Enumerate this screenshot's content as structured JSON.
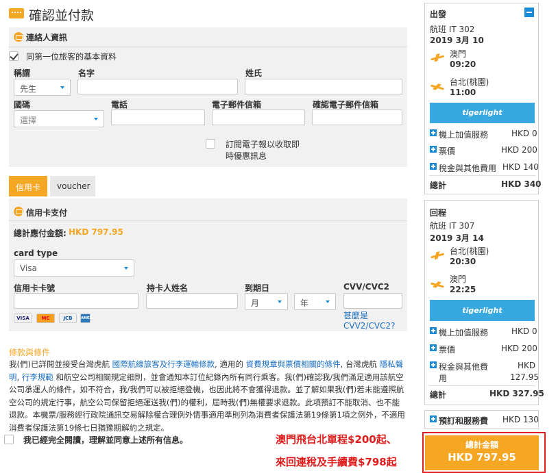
{
  "page_title": "確認並付款",
  "contact": {
    "section_title": "連絡人資訊",
    "same_as_first": "同第一位旅客的基本資料",
    "title_label": "稱謂",
    "title_value": "先生",
    "first_name_label": "名字",
    "last_name_label": "姓氏",
    "country_label": "國碼",
    "country_placeholder": "選擇",
    "phone_label": "電話",
    "email_label": "電子郵件信箱",
    "confirm_email_label": "確認電子郵件信箱",
    "newsletter_line1": "訂閱電子報以收取即",
    "newsletter_line2": "時優惠訊息"
  },
  "payment_tabs": [
    "信用卡",
    "voucher"
  ],
  "card": {
    "section_title": "信用卡支付",
    "total_label": "總計應付金額:",
    "total_value": "HKD 797.95",
    "card_type_label": "card type",
    "card_type_value": "Visa",
    "number_label": "信用卡卡號",
    "holder_label": "持卡人姓名",
    "expiry_label": "到期日",
    "month_placeholder": "月",
    "year_placeholder": "年",
    "cvv_label": "CVV/CVC2",
    "cvv_help_1": "甚麼是",
    "cvv_help_2": "CVV2/CVC2?",
    "brands": [
      "VISA",
      "MC",
      "JCB",
      "AMEX"
    ]
  },
  "terms": {
    "title": "條款與條件",
    "t1": "我(們)已詳閱並接受台灣虎航 ",
    "l1": "國際航線旅客及行李運輸條款",
    "t2": ", 適用的 ",
    "l2": "資費規章與票價相關的條件",
    "t3": ", 台灣虎航 ",
    "l3": "隱私聲明",
    "t4": ", ",
    "l4": "行李規範",
    "t5": " 和航空公司相關規定細則，並會通知本訂位紀錄內所有同行乘客。我(們)確認我/我們滿足適用該航空公司承運人的條件，如不符合，我/我們可以被拒絕登機，也因此將不會獲得退款。並了解如果我(們)若未能遵照航空公司的規定行事，航空公司保留拒絕運送我(們)的權利，屆時我(們)無權要求退款。此項預訂不能取消、也不能退款。本機票/服務經行政院通訊交易解除權合理例外情事適用準則列為消費者保護法第19條第1項之例外，不適用消費者保護法第19條七日猶豫期解約之規定。",
    "agree": "我已經完全閱讀，理解並同意上述所有信息。"
  },
  "promo": {
    "line1": "澳門飛台北單程$200起、",
    "line2": "來回連稅及手續費$798起"
  },
  "outbound": {
    "title": "出發",
    "flight": "航班 IT 302",
    "date": "2019 3月 10",
    "from": "澳門",
    "dep_time": "09:20",
    "to": "台北(桃園)",
    "arr_time": "11:00",
    "brand": "tigerlight",
    "services_label": "機上加值服務",
    "services_value": "HKD 0",
    "fare_label": "票價",
    "fare_value": "HKD 200",
    "tax_label": "稅金與其他費用",
    "tax_value": "HKD 140",
    "total_label": "總計",
    "total_value": "HKD 340"
  },
  "inbound": {
    "title": "回程",
    "flight": "航班 IT 307",
    "date": "2019 3月 14",
    "from": "台北(桃園)",
    "dep_time": "20:30",
    "to": "澳門",
    "arr_time": "22:25",
    "brand": "tigerlight",
    "services_label": "機上加值服務",
    "services_value": "HKD 0",
    "fare_label": "票價",
    "fare_value": "HKD 200",
    "tax_label_1": "稅金與其他費",
    "tax_label_2": "用",
    "tax_value_1": "HKD",
    "tax_value_2": "127.95",
    "total_label": "總計",
    "total_value": "HKD 327.95"
  },
  "booking_fee": {
    "label": "預訂和服務費",
    "value": "HKD 130"
  },
  "grand_total": {
    "label": "總計金額",
    "value": "HKD 797.95"
  },
  "colors": {
    "accent": "#f5a623",
    "link": "#1a6fc2",
    "promo": "#e01b1b",
    "brand_blue": "#38a8e0"
  }
}
